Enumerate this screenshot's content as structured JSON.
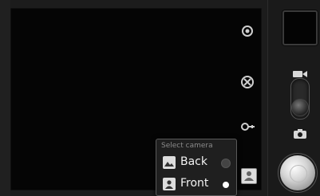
{
  "camera_selector": {
    "title": "Select camera",
    "options": [
      {
        "label": "Back",
        "icon": "landscape-icon",
        "selected": false
      },
      {
        "label": "Front",
        "icon": "portrait-icon",
        "selected": true
      }
    ]
  },
  "side_controls": {
    "icons": [
      "settings-icon",
      "white-balance-icon",
      "zoom-icon",
      "camera-select-icon"
    ]
  },
  "rail": {
    "mode_icons": [
      "video-mode-icon",
      "photo-mode-icon"
    ],
    "mode_selected": "photo"
  }
}
